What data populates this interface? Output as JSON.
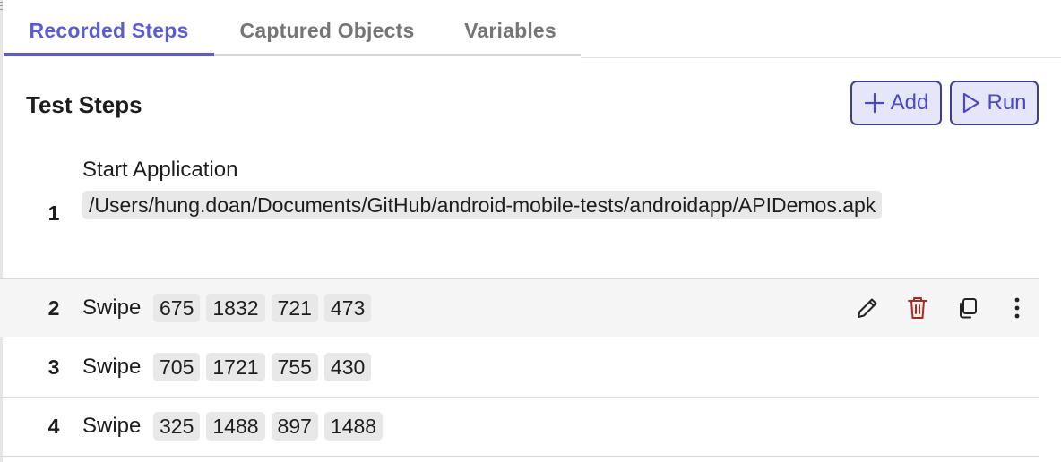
{
  "tabs": [
    {
      "label": "Recorded Steps",
      "active": true
    },
    {
      "label": "Captured Objects",
      "active": false
    },
    {
      "label": "Variables",
      "active": false
    }
  ],
  "section": {
    "title": "Test Steps"
  },
  "buttons": {
    "add_label": "Add",
    "run_label": "Run",
    "add_icon": "plus-icon",
    "run_icon": "play-icon"
  },
  "steps": [
    {
      "number": "1",
      "title": "Start Application",
      "path": "/Users/hung.doan/Documents/GitHub/android-mobile-tests/androidapp/APIDemos.apk"
    },
    {
      "number": "2",
      "action": "Swipe",
      "params": [
        "675",
        "1832",
        "721",
        "473"
      ]
    },
    {
      "number": "3",
      "action": "Swipe",
      "params": [
        "705",
        "1721",
        "755",
        "430"
      ]
    },
    {
      "number": "4",
      "action": "Swipe",
      "params": [
        "325",
        "1488",
        "897",
        "1488"
      ]
    }
  ],
  "row_actions": {
    "icons": [
      "pencil-icon",
      "trash-icon",
      "copy-icon",
      "more-vertical-icon"
    ]
  },
  "colors": {
    "accent": "#5b5bd6",
    "button_bg": "#e6e6fa",
    "button_border": "#3e3e8c",
    "delete": "#b3261e",
    "chip_bg": "#e8e8e8"
  }
}
